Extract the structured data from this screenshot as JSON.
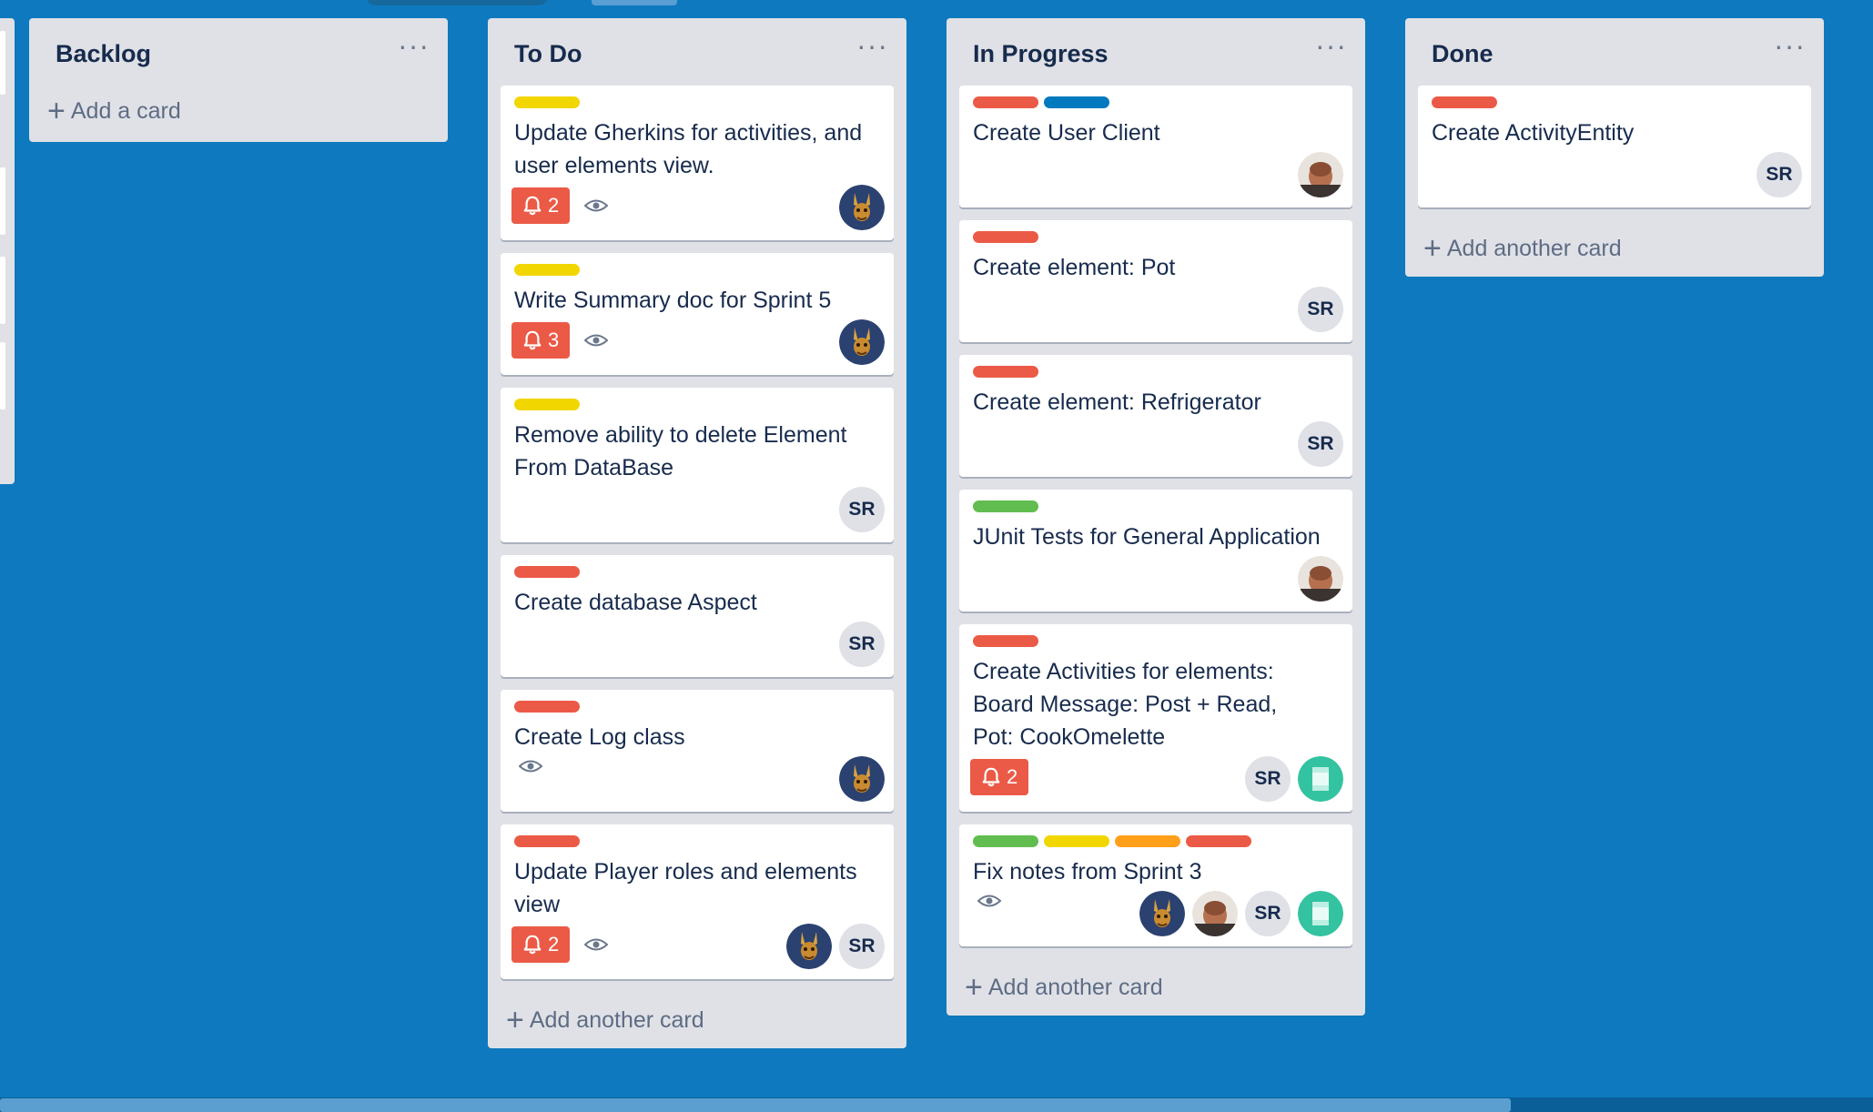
{
  "board": {
    "lists": [
      {
        "title": "Backlog",
        "menu_icon": "ellipsis-icon",
        "add_label": "Add a card",
        "cards": []
      },
      {
        "title": "To Do",
        "menu_icon": "ellipsis-icon",
        "add_label": "Add another card",
        "cards": [
          {
            "labels": [
              "#f2d600"
            ],
            "title": "Update Gherkins for activities, and user elements view.",
            "notifications": "2",
            "watched": true,
            "members": [
              "rabbit"
            ]
          },
          {
            "labels": [
              "#f2d600"
            ],
            "title": "Write Summary doc for Sprint 5",
            "notifications": "3",
            "watched": true,
            "members": [
              "rabbit"
            ]
          },
          {
            "labels": [
              "#f2d600"
            ],
            "title": "Remove ability to delete Element From DataBase",
            "notifications": "",
            "watched": false,
            "members": [
              "SR"
            ]
          },
          {
            "labels": [
              "#eb5a46"
            ],
            "title": "Create database Aspect",
            "notifications": "",
            "watched": false,
            "members": [
              "SR"
            ]
          },
          {
            "labels": [
              "#eb5a46"
            ],
            "title": "Create Log class",
            "notifications": "",
            "watched": true,
            "members": [
              "rabbit"
            ]
          },
          {
            "labels": [
              "#eb5a46"
            ],
            "title": "Update Player roles and elements view",
            "notifications": "2",
            "watched": true,
            "members": [
              "rabbit",
              "SR"
            ]
          }
        ]
      },
      {
        "title": "In Progress",
        "menu_icon": "ellipsis-icon",
        "add_label": "Add another card",
        "cards": [
          {
            "labels": [
              "#eb5a46",
              "#0079bf"
            ],
            "title": "Create User Client",
            "notifications": "",
            "watched": false,
            "members": [
              "photo"
            ]
          },
          {
            "labels": [
              "#eb5a46"
            ],
            "title": "Create element: Pot",
            "notifications": "",
            "watched": false,
            "members": [
              "SR"
            ]
          },
          {
            "labels": [
              "#eb5a46"
            ],
            "title": "Create element: Refrigerator",
            "notifications": "",
            "watched": false,
            "members": [
              "SR"
            ]
          },
          {
            "labels": [
              "#61bd4f"
            ],
            "title": "JUnit Tests for General Application",
            "notifications": "",
            "watched": false,
            "members": [
              "photo"
            ]
          },
          {
            "labels": [
              "#eb5a46"
            ],
            "title": "Create Activities for elements: Board Message: Post + Read, Pot: CookOmelette",
            "notifications": "2",
            "watched": false,
            "members": [
              "SR",
              "teal"
            ]
          },
          {
            "labels": [
              "#61bd4f",
              "#f2d600",
              "#ff9f1a",
              "#eb5a46"
            ],
            "title": "Fix notes from Sprint 3",
            "notifications": "",
            "watched": true,
            "members": [
              "rabbit",
              "photo",
              "SR",
              "teal"
            ]
          }
        ]
      },
      {
        "title": "Done",
        "menu_icon": "ellipsis-icon",
        "add_label": "Add another card",
        "cards": [
          {
            "labels": [
              "#eb5a46"
            ],
            "title": "Create ActivityEntity",
            "notifications": "",
            "watched": false,
            "members": [
              "SR"
            ]
          }
        ]
      }
    ]
  },
  "icons": {
    "notification": "bell-icon",
    "watch": "eye-icon",
    "add": "plus-icon",
    "menu": "ellipsis-icon"
  },
  "colors": {
    "board_background": "#0e79bf",
    "list_background": "#dfe1e6",
    "badge_red": "#eb5a46"
  }
}
